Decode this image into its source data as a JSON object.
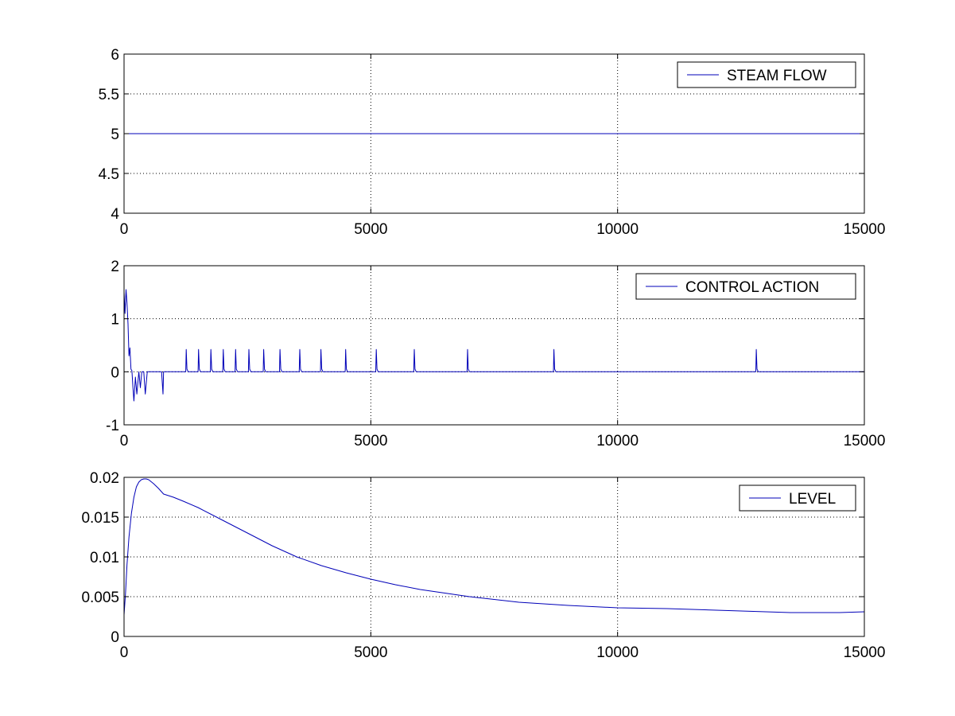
{
  "colors": {
    "line": "#0000b8",
    "axes": "#000000",
    "grid": "#000000",
    "background": "#ffffff"
  },
  "chart_data": [
    {
      "type": "line",
      "title": "",
      "xlabel": "",
      "ylabel": "",
      "xlim": [
        0,
        15000
      ],
      "ylim": [
        4,
        6
      ],
      "grid": true,
      "legend_position": "top-right",
      "xticks": [
        0,
        5000,
        10000,
        15000
      ],
      "xtick_labels": [
        "0",
        "5000",
        "10000",
        "15000"
      ],
      "yticks": [
        4,
        4.5,
        5,
        5.5,
        6
      ],
      "ytick_labels": [
        "4",
        "4.5",
        "5",
        "5.5",
        "6"
      ],
      "series": [
        {
          "name": "STEAM FLOW",
          "x": [
            0,
            15000
          ],
          "y": [
            5,
            5
          ]
        }
      ]
    },
    {
      "type": "line",
      "title": "",
      "xlabel": "",
      "ylabel": "",
      "xlim": [
        0,
        15000
      ],
      "ylim": [
        -1,
        2
      ],
      "grid": true,
      "legend_position": "top-right",
      "xticks": [
        0,
        5000,
        10000,
        15000
      ],
      "xtick_labels": [
        "0",
        "5000",
        "10000",
        "15000"
      ],
      "yticks": [
        -1,
        0,
        1,
        2
      ],
      "ytick_labels": [
        "-1",
        "0",
        "1",
        "2"
      ],
      "series": [
        {
          "name": "CONTROL ACTION",
          "x": [
            0,
            20,
            40,
            60,
            80,
            100,
            120,
            140,
            160,
            180,
            200,
            230,
            260,
            300,
            330,
            360,
            400,
            430,
            470,
            520,
            600,
            700,
            760,
            790,
            800,
            1250,
            1260,
            1275,
            1300,
            1500,
            1510,
            1525,
            1550,
            1750,
            1760,
            1775,
            1800,
            2000,
            2010,
            2025,
            2050,
            2250,
            2260,
            2275,
            2300,
            2520,
            2530,
            2545,
            2570,
            2820,
            2830,
            2845,
            2870,
            3150,
            3160,
            3175,
            3200,
            3550,
            3560,
            3575,
            3600,
            3980,
            3990,
            4005,
            4030,
            4480,
            4490,
            4505,
            4530,
            5100,
            5110,
            5125,
            5150,
            5870,
            5880,
            5895,
            5920,
            6950,
            6960,
            6975,
            7000,
            8700,
            8710,
            8725,
            8750,
            12800,
            12810,
            12825,
            12850,
            15000
          ],
          "y": [
            1.5,
            1.1,
            1.55,
            1.3,
            0.9,
            0.3,
            0.45,
            0.05,
            0.02,
            -0.3,
            -0.55,
            -0.1,
            -0.42,
            0.0,
            -0.3,
            0.0,
            0.0,
            -0.42,
            0.0,
            0.0,
            0.0,
            0.0,
            0.0,
            -0.42,
            0.0,
            0.0,
            0.42,
            0.05,
            0.0,
            0.0,
            0.42,
            0.05,
            0.0,
            0.0,
            0.42,
            0.05,
            0.0,
            0.0,
            0.42,
            0.05,
            0.0,
            0.0,
            0.42,
            0.05,
            0.0,
            0.0,
            0.42,
            0.05,
            0.0,
            0.0,
            0.42,
            0.05,
            0.0,
            0.0,
            0.42,
            0.05,
            0.0,
            0.0,
            0.42,
            0.05,
            0.0,
            0.0,
            0.42,
            0.05,
            0.0,
            0.0,
            0.42,
            0.05,
            0.0,
            0.0,
            0.42,
            0.05,
            0.0,
            0.0,
            0.42,
            0.05,
            0.0,
            0.0,
            0.42,
            0.05,
            0.0,
            0.0,
            0.42,
            0.05,
            0.0,
            0.0,
            0.42,
            0.05,
            0.0,
            0.0
          ]
        }
      ]
    },
    {
      "type": "line",
      "title": "",
      "xlabel": "",
      "ylabel": "",
      "xlim": [
        0,
        15000
      ],
      "ylim": [
        0,
        0.02
      ],
      "grid": true,
      "legend_position": "top-right",
      "xticks": [
        0,
        5000,
        10000,
        15000
      ],
      "xtick_labels": [
        "0",
        "5000",
        "10000",
        "15000"
      ],
      "yticks": [
        0,
        0.005,
        0.01,
        0.015,
        0.02
      ],
      "ytick_labels": [
        "0",
        "0.005",
        "0.01",
        "0.015",
        "0.02"
      ],
      "series": [
        {
          "name": "LEVEL",
          "x": [
            0,
            30,
            60,
            100,
            150,
            200,
            250,
            300,
            350,
            400,
            450,
            500,
            600,
            700,
            800,
            900,
            1000,
            1200,
            1500,
            2000,
            2500,
            3000,
            3500,
            4000,
            4500,
            5000,
            5500,
            6000,
            7000,
            8000,
            9000,
            10000,
            11000,
            12000,
            13000,
            13500,
            14000,
            14500,
            15000
          ],
          "y": [
            0.0027,
            0.0055,
            0.009,
            0.0125,
            0.0155,
            0.0175,
            0.0188,
            0.0194,
            0.0197,
            0.0198,
            0.0198,
            0.0197,
            0.0192,
            0.0186,
            0.0179,
            0.0177,
            0.0175,
            0.017,
            0.0162,
            0.0146,
            0.013,
            0.0114,
            0.01,
            0.0089,
            0.008,
            0.0072,
            0.0065,
            0.0059,
            0.005,
            0.0043,
            0.0039,
            0.0036,
            0.0035,
            0.0033,
            0.0031,
            0.003,
            0.003,
            0.003,
            0.0031
          ]
        }
      ]
    }
  ]
}
